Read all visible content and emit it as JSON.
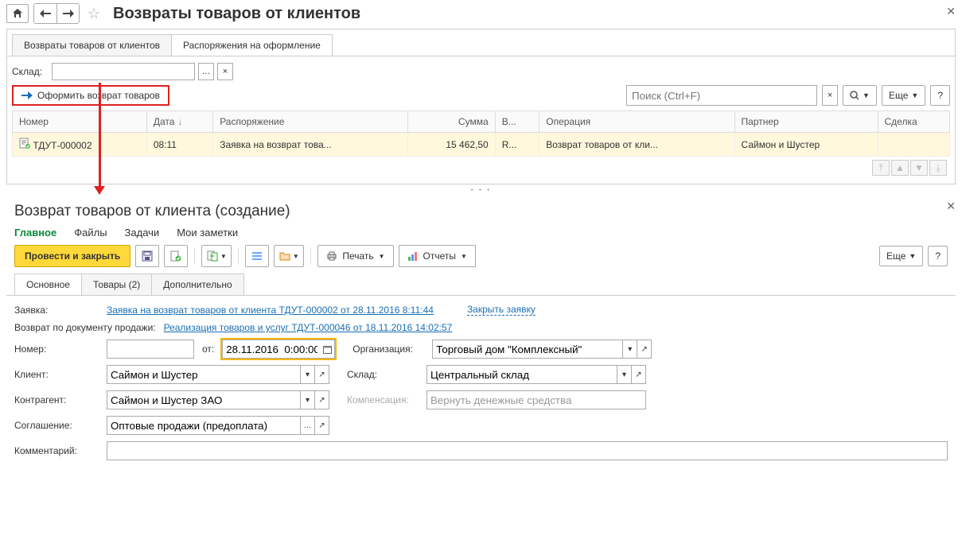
{
  "top": {
    "title": "Возвраты товаров от клиентов",
    "tabs": [
      "Возвраты товаров от клиентов",
      "Распоряжения на оформление"
    ],
    "sklad_label": "Склад:",
    "create_button": "Оформить возврат товаров",
    "search_placeholder": "Поиск (Ctrl+F)",
    "more_button": "Еще",
    "help_button": "?",
    "columns": {
      "number": "Номер",
      "date": "Дата",
      "order": "Распоряжение",
      "sum": "Сумма",
      "currency": "В...",
      "operation": "Операция",
      "partner": "Партнер",
      "deal": "Сделка"
    },
    "row": {
      "number": "ТДУТ-000002",
      "date": "08:11",
      "order": "Заявка на возврат това...",
      "sum": "15 462,50",
      "currency": "R...",
      "operation": "Возврат товаров от кли...",
      "partner": "Саймон и Шустер",
      "deal": ""
    }
  },
  "bottom": {
    "title": "Возврат товаров от клиента (создание)",
    "sections": [
      "Главное",
      "Файлы",
      "Задачи",
      "Мои заметки"
    ],
    "save_close": "Провести и закрыть",
    "print": "Печать",
    "reports": "Отчеты",
    "more": "Еще",
    "help": "?",
    "tabs": {
      "main": "Основное",
      "goods": "Товары (2)",
      "extra": "Дополнительно"
    },
    "request_label": "Заявка:",
    "request_link": "Заявка на возврат товаров от клиента ТДУТ-000002 от 28.11.2016 8:11:44",
    "close_request": "Закрыть заявку",
    "return_doc_label": "Возврат по документу продажи:",
    "return_doc_link": "Реализация товаров и услуг ТДУТ-000046 от 18.11.2016 14:02:57",
    "number_label": "Номер:",
    "from_label": "от:",
    "date_value": "28.11.2016  0:00:00",
    "org_label": "Организация:",
    "org_value": "Торговый дом \"Комплексный\"",
    "client_label": "Клиент:",
    "client_value": "Саймон и Шустер",
    "sklad_label": "Склад:",
    "sklad_value": "Центральный склад",
    "contr_label": "Контрагент:",
    "contr_value": "Саймон и Шустер ЗАО",
    "comp_label": "Компенсация:",
    "comp_value": "Вернуть денежные средства",
    "agree_label": "Соглашение:",
    "agree_value": "Оптовые продажи (предоплата)",
    "comment_label": "Комментарий:"
  }
}
